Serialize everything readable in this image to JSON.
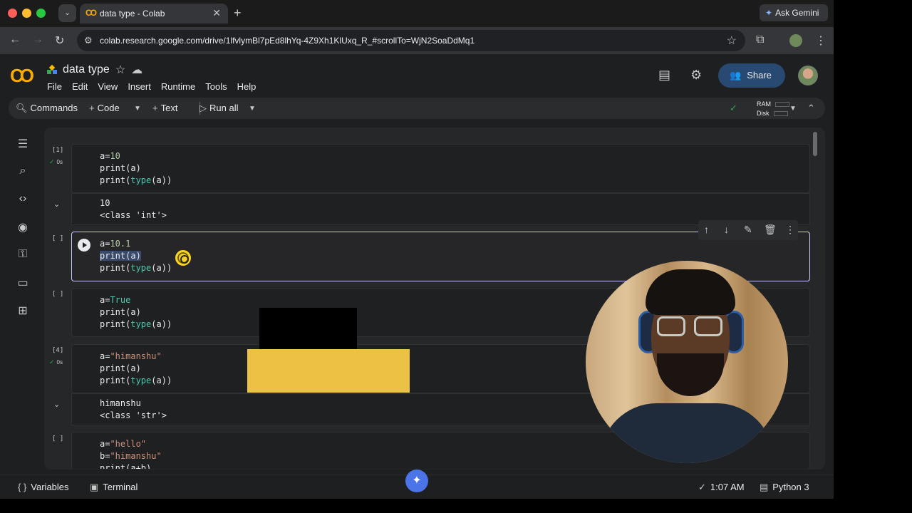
{
  "browser": {
    "tab_title": "data type - Colab",
    "tab_favicon": "CO",
    "tab_close": "✕",
    "new_tab": "+",
    "tab_dropdown": "⌄",
    "ask_gemini": "Ask Gemini",
    "url": "colab.research.google.com/drive/1lfvlymBl7pEd8lhYq-4Z9Xh1KlUxq_R_#scrollTo=WjN2SoaDdMq1"
  },
  "colab": {
    "logo": "CO",
    "notebook_name": "data type",
    "menu": [
      "File",
      "Edit",
      "View",
      "Insert",
      "Runtime",
      "Tools",
      "Help"
    ],
    "share_label": "Share"
  },
  "toolbar": {
    "commands": "Commands",
    "code": "Code",
    "text": "Text",
    "run_all": "Run all",
    "ram": "RAM",
    "disk": "Disk"
  },
  "cells": {
    "c1": {
      "exec_count": "[1]",
      "time": "0s",
      "output": [
        "10",
        "<class 'int'>"
      ]
    },
    "c2": {
      "exec_count": "[ ]"
    },
    "c3": {
      "exec_count": "[ ]"
    },
    "c4": {
      "exec_count": "[4]",
      "time": "0s",
      "output": [
        "himanshu",
        "<class 'str'>"
      ]
    },
    "c5": {
      "exec_count": "[ ]"
    }
  },
  "statusbar": {
    "variables": "Variables",
    "terminal": "Terminal",
    "time": "1:07 AM",
    "kernel": "Python 3"
  },
  "colors": {
    "accent": "#f9ab00",
    "share_bg": "#284a72",
    "active_cell_border": "#c6c9ff",
    "ok_green": "#34a853"
  }
}
